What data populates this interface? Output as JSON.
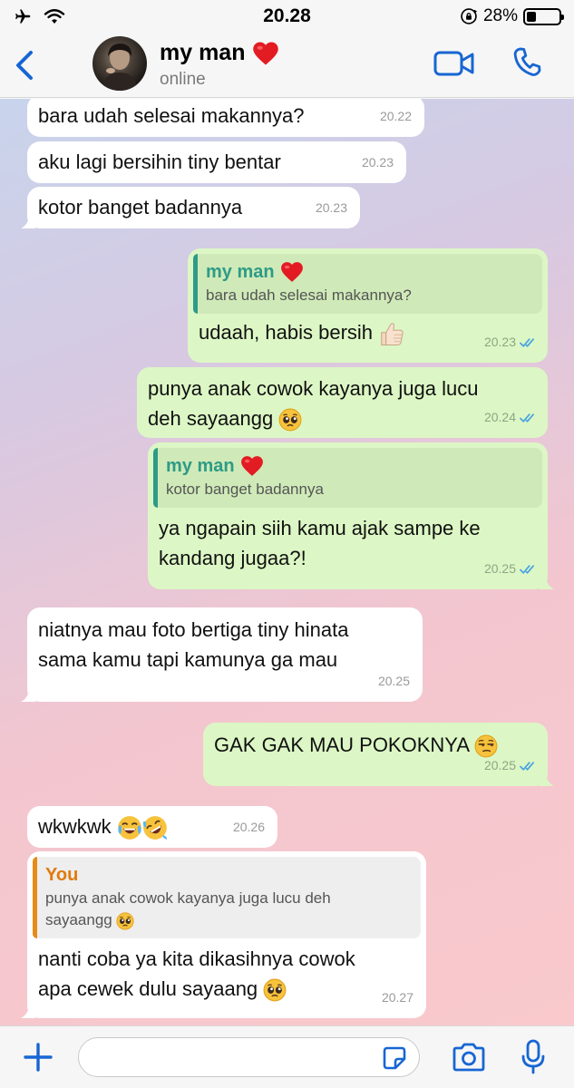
{
  "status_bar": {
    "time": "20.28",
    "battery": "28%",
    "battery_level": 0.28
  },
  "header": {
    "contact_name": "my man",
    "contact_status": "online"
  },
  "messages": [
    {
      "text": "bara udah selesai makannya?",
      "time": "20.22"
    },
    {
      "text": "aku lagi bersihin tiny bentar",
      "time": "20.23"
    },
    {
      "text": "kotor banget badannya",
      "time": "20.23"
    },
    {
      "quote_author": "my man",
      "quote_text": "bara udah selesai makannya?",
      "text": "udaah, habis bersih",
      "time": "20.23"
    },
    {
      "text_line1": "punya anak cowok kayanya juga lucu",
      "text_line2": "deh sayaangg",
      "time": "20.24"
    },
    {
      "quote_author": "my man",
      "quote_text": "kotor banget badannya",
      "text_line1": "ya ngapain siih kamu ajak sampe ke",
      "text_line2": "kandang jugaa?!",
      "time": "20.25"
    },
    {
      "text_line1": "niatnya mau foto bertiga tiny hinata",
      "text_line2": "sama kamu tapi kamunya ga mau",
      "time": "20.25"
    },
    {
      "text": "GAK GAK MAU POKOKNYA",
      "time": "20.25"
    },
    {
      "text": "wkwkwk",
      "time": "20.26"
    },
    {
      "quote_author": "You",
      "quote_text_line1": "punya anak cowok kayanya juga lucu deh",
      "quote_text_line2": "sayaangg",
      "text_line1": "nanti coba ya kita dikasihnya cowok",
      "text_line2": "apa cewek dulu sayaang",
      "time": "20.27"
    }
  ],
  "input": {
    "value": "",
    "placeholder": ""
  },
  "icons": {
    "status": [
      "airplane-icon",
      "wifi-icon",
      "orientation-lock-icon",
      "battery-icon"
    ],
    "header": [
      "back-icon",
      "video-call-icon",
      "voice-call-icon"
    ],
    "input_bar": [
      "plus-icon",
      "sticker-icon",
      "camera-icon",
      "microphone-icon"
    ],
    "emoji": [
      "red-heart-emoji",
      "thumbs-up-emoji",
      "pleading-face-emoji",
      "unamused-face-emoji",
      "tears-of-joy-emoji",
      "rofl-emoji"
    ]
  },
  "colors": {
    "accent_blue": "#1766d3",
    "outgoing_bubble": "#dcf7c5",
    "incoming_bubble": "#ffffff",
    "quote_green": "#2d9b87",
    "quote_orange": "#e07b0e",
    "read_tick_blue": "#4aa3e0"
  }
}
